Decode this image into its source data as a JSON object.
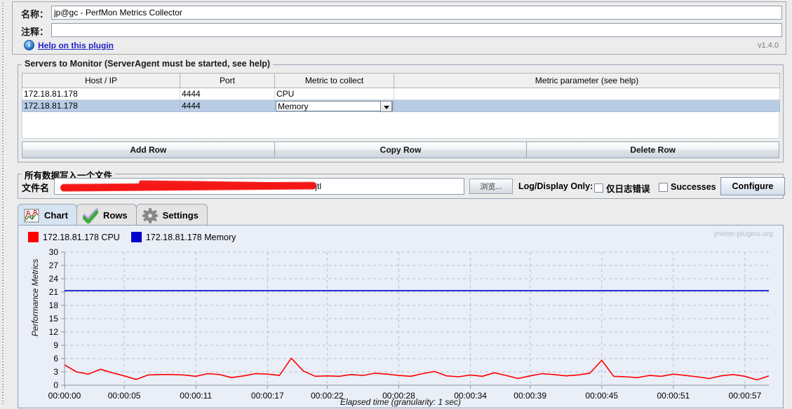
{
  "form": {
    "name_label": "名称：",
    "name_value": "jp@gc - PerfMon Metrics Collector",
    "comment_label": "注释：",
    "comment_value": "",
    "help_link": "Help on this plugin",
    "version": "v1.4.0"
  },
  "servers_group": {
    "title": "Servers to Monitor (ServerAgent must be started, see help)",
    "columns": [
      "Host / IP",
      "Port",
      "Metric to collect",
      "Metric parameter (see help)"
    ],
    "rows": [
      {
        "host": "172.18.81.178",
        "port": "4444",
        "metric": "CPU",
        "param": "",
        "selected": false
      },
      {
        "host": "172.18.81.178",
        "port": "4444",
        "metric": "Memory",
        "param": "",
        "selected": true
      }
    ]
  },
  "buttons": {
    "add_row": "Add Row",
    "copy_row": "Copy Row",
    "delete_row": "Delete Row"
  },
  "file_group": {
    "title": "所有数据写入一个文件",
    "filename_label": "文件名",
    "filename_value": ".jtl",
    "browse_label": "浏览...",
    "log_display_label": "Log/Display Only:",
    "errors_only_label": "仅日志错误",
    "successes_label": "Successes",
    "errors_only_checked": false,
    "successes_checked": false,
    "configure_label": "Configure"
  },
  "tabs": [
    {
      "label": "Chart",
      "icon": "chart-icon",
      "active": true
    },
    {
      "label": "Rows",
      "icon": "check-icon",
      "active": false
    },
    {
      "label": "Settings",
      "icon": "gear-icon",
      "active": false
    }
  ],
  "chart_data": {
    "type": "line",
    "title": "",
    "watermark": "jmeter-plugins.org",
    "xlabel": "Elapsed time (granularity: 1 sec)",
    "ylabel": "Performance Metrics",
    "ylim": [
      0,
      30
    ],
    "yticks": [
      0,
      3,
      6,
      9,
      12,
      15,
      18,
      21,
      24,
      27,
      30
    ],
    "grid": true,
    "legend_position": "top-left",
    "xtick_labels": [
      "00:00:00",
      "00:00:05",
      "00:00:11",
      "00:00:17",
      "00:00:22",
      "00:00:28",
      "00:00:34",
      "00:00:39",
      "00:00:45",
      "00:00:51",
      "00:00:57"
    ],
    "xtick_seconds": [
      0,
      5,
      11,
      17,
      22,
      28,
      34,
      39,
      45,
      51,
      57
    ],
    "xlim_seconds": [
      0,
      59
    ],
    "series": [
      {
        "name": "172.18.81.178 CPU",
        "color": "#ff0000",
        "x": [
          0,
          1,
          2,
          3,
          4,
          5,
          6,
          7,
          8,
          9,
          10,
          11,
          12,
          13,
          14,
          15,
          16,
          17,
          18,
          19,
          20,
          21,
          22,
          23,
          24,
          25,
          26,
          27,
          28,
          29,
          30,
          31,
          32,
          33,
          34,
          35,
          36,
          37,
          38,
          39,
          40,
          41,
          42,
          43,
          44,
          45,
          46,
          47,
          48,
          49,
          50,
          51,
          52,
          53,
          54,
          55,
          56,
          57,
          58,
          59
        ],
        "y": [
          4.6,
          3.0,
          2.5,
          3.6,
          2.8,
          2.1,
          1.3,
          2.3,
          2.4,
          2.4,
          2.3,
          2.0,
          2.6,
          2.4,
          1.7,
          2.1,
          2.6,
          2.5,
          2.2,
          6.1,
          3.2,
          2.0,
          2.1,
          2.0,
          2.4,
          2.2,
          2.7,
          2.5,
          2.2,
          2.0,
          2.6,
          3.1,
          2.1,
          1.9,
          2.3,
          2.0,
          2.8,
          2.2,
          1.5,
          2.1,
          2.6,
          2.4,
          2.1,
          2.3,
          2.7,
          5.6,
          2.0,
          1.9,
          1.7,
          2.2,
          2.0,
          2.5,
          2.2,
          1.9,
          1.5,
          2.1,
          2.4,
          2.0,
          1.2,
          2.1
        ]
      },
      {
        "name": "172.18.81.178 Memory",
        "color": "#0000cc",
        "x": [
          0,
          59
        ],
        "y": [
          21.3,
          21.3
        ]
      }
    ]
  }
}
